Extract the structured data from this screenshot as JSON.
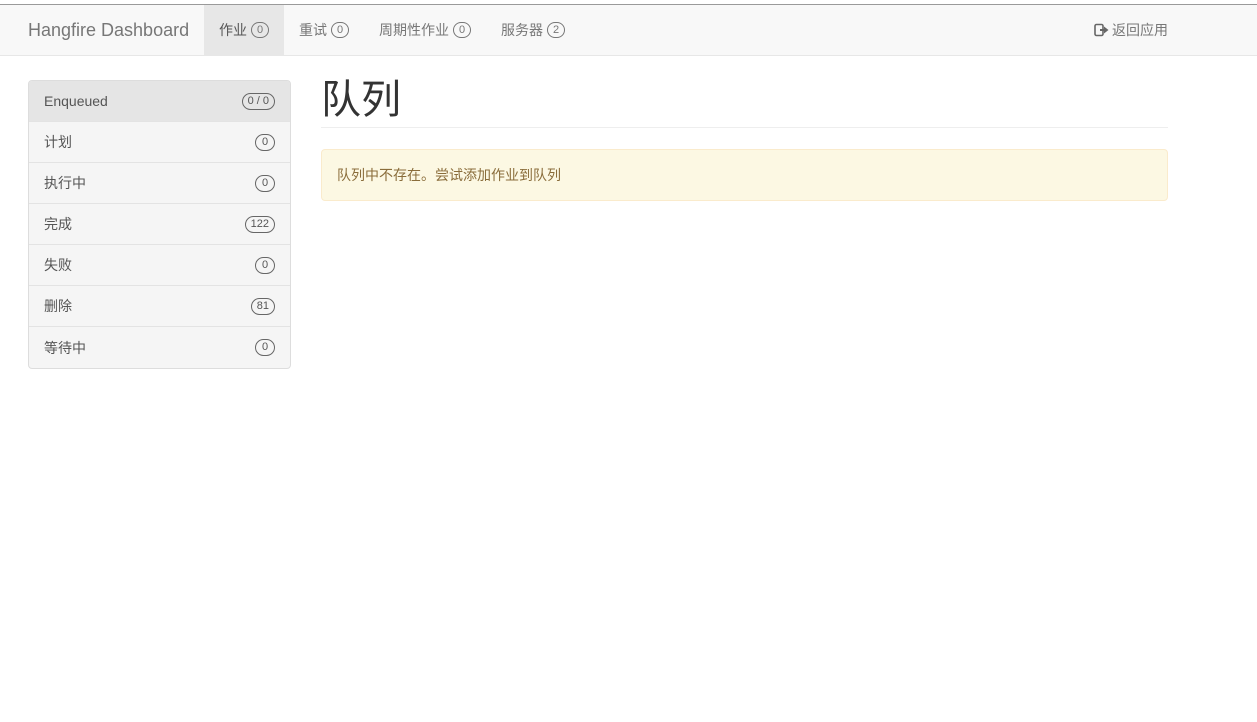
{
  "navbar": {
    "brand": "Hangfire Dashboard",
    "items": [
      {
        "label": "作业",
        "badge": "0",
        "active": true
      },
      {
        "label": "重试",
        "badge": "0"
      },
      {
        "label": "周期性作业",
        "badge": "0"
      },
      {
        "label": "服务器",
        "badge": "2"
      }
    ],
    "return_label": "返回应用",
    "return_icon": "sign-out-icon"
  },
  "sidebar": {
    "items": [
      {
        "label": "Enqueued",
        "badge": "0 / 0",
        "active": true
      },
      {
        "label": "计划",
        "badge": "0"
      },
      {
        "label": "执行中",
        "badge": "0"
      },
      {
        "label": "完成",
        "badge": "122"
      },
      {
        "label": "失败",
        "badge": "0"
      },
      {
        "label": "删除",
        "badge": "81"
      },
      {
        "label": "等待中",
        "badge": "0"
      }
    ]
  },
  "main": {
    "title": "队列",
    "alert": "队列中不存在。尝试添加作业到队列"
  },
  "colors": {
    "navbar_bg": "#f8f8f8",
    "alert_bg": "#fcf8e3",
    "alert_text": "#8a6d3b"
  }
}
